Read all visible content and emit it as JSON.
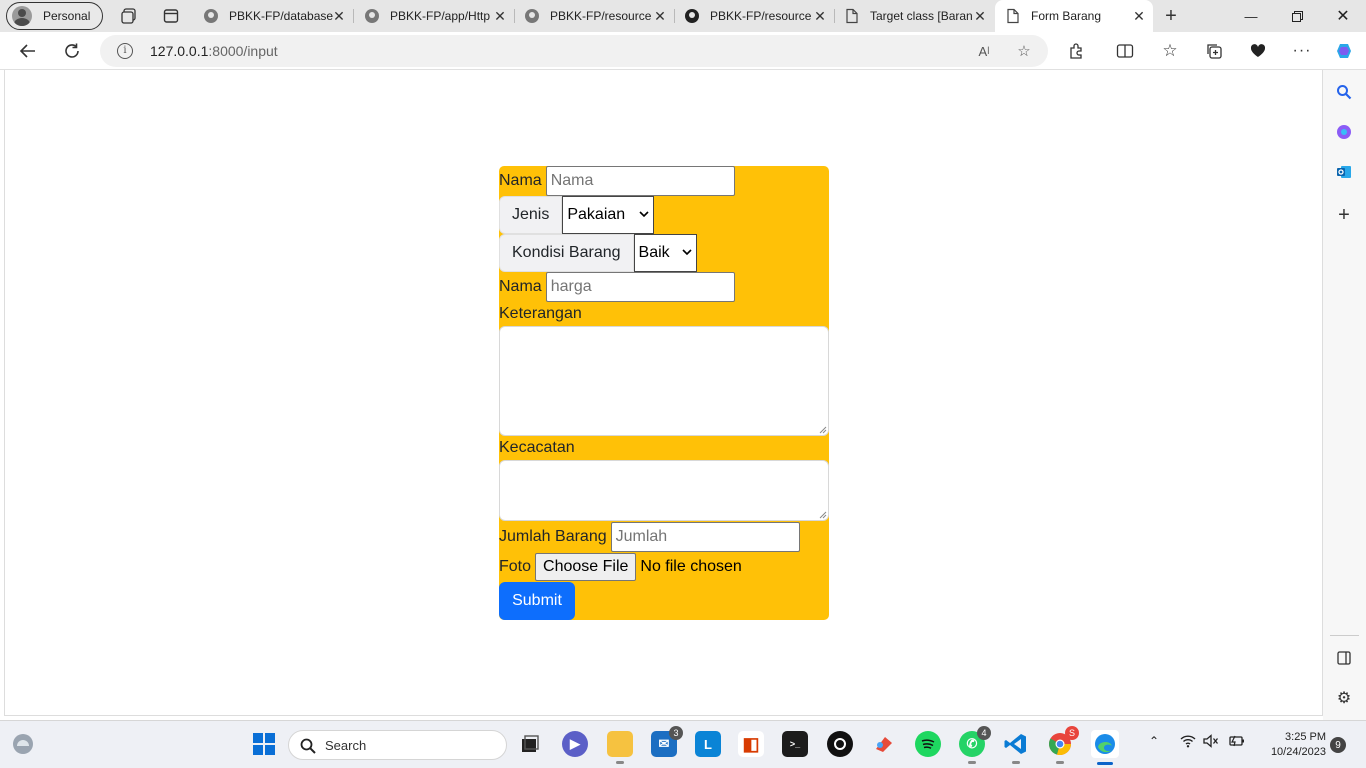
{
  "browser": {
    "profile_label": "Personal",
    "tabs": [
      {
        "title": "PBKK-FP/database"
      },
      {
        "title": "PBKK-FP/app/Http"
      },
      {
        "title": "PBKK-FP/resource"
      },
      {
        "title": "PBKK-FP/resource"
      },
      {
        "title": "Target class [Baran"
      },
      {
        "title": "Form Barang"
      }
    ],
    "address": {
      "host": "127.0.0.1",
      "path": ":8000/input"
    }
  },
  "form": {
    "nama_label": "Nama",
    "nama_placeholder": "Nama",
    "jenis_label": "Jenis",
    "jenis_value": "Pakaian",
    "kondisi_label": "Kondisi Barang",
    "kondisi_value": "Baik",
    "harga_label": "Nama",
    "harga_placeholder": "harga",
    "keterangan_label": "Keterangan",
    "kecacatan_label": "Kecacatan",
    "jumlah_label": "Jumlah Barang",
    "jumlah_placeholder": "Jumlah",
    "foto_label": "Foto",
    "file_button": "Choose File",
    "file_status": "No file chosen",
    "submit_label": "Submit",
    "colors": {
      "form_bg": "#ffc107",
      "submit_bg": "#0d6efd"
    }
  },
  "taskbar": {
    "search_label": "Search",
    "badges": {
      "mail": "3",
      "whatsapp": "4",
      "chrome": "S"
    },
    "time": "3:25 PM",
    "date": "10/24/2023",
    "notifications": "9"
  }
}
